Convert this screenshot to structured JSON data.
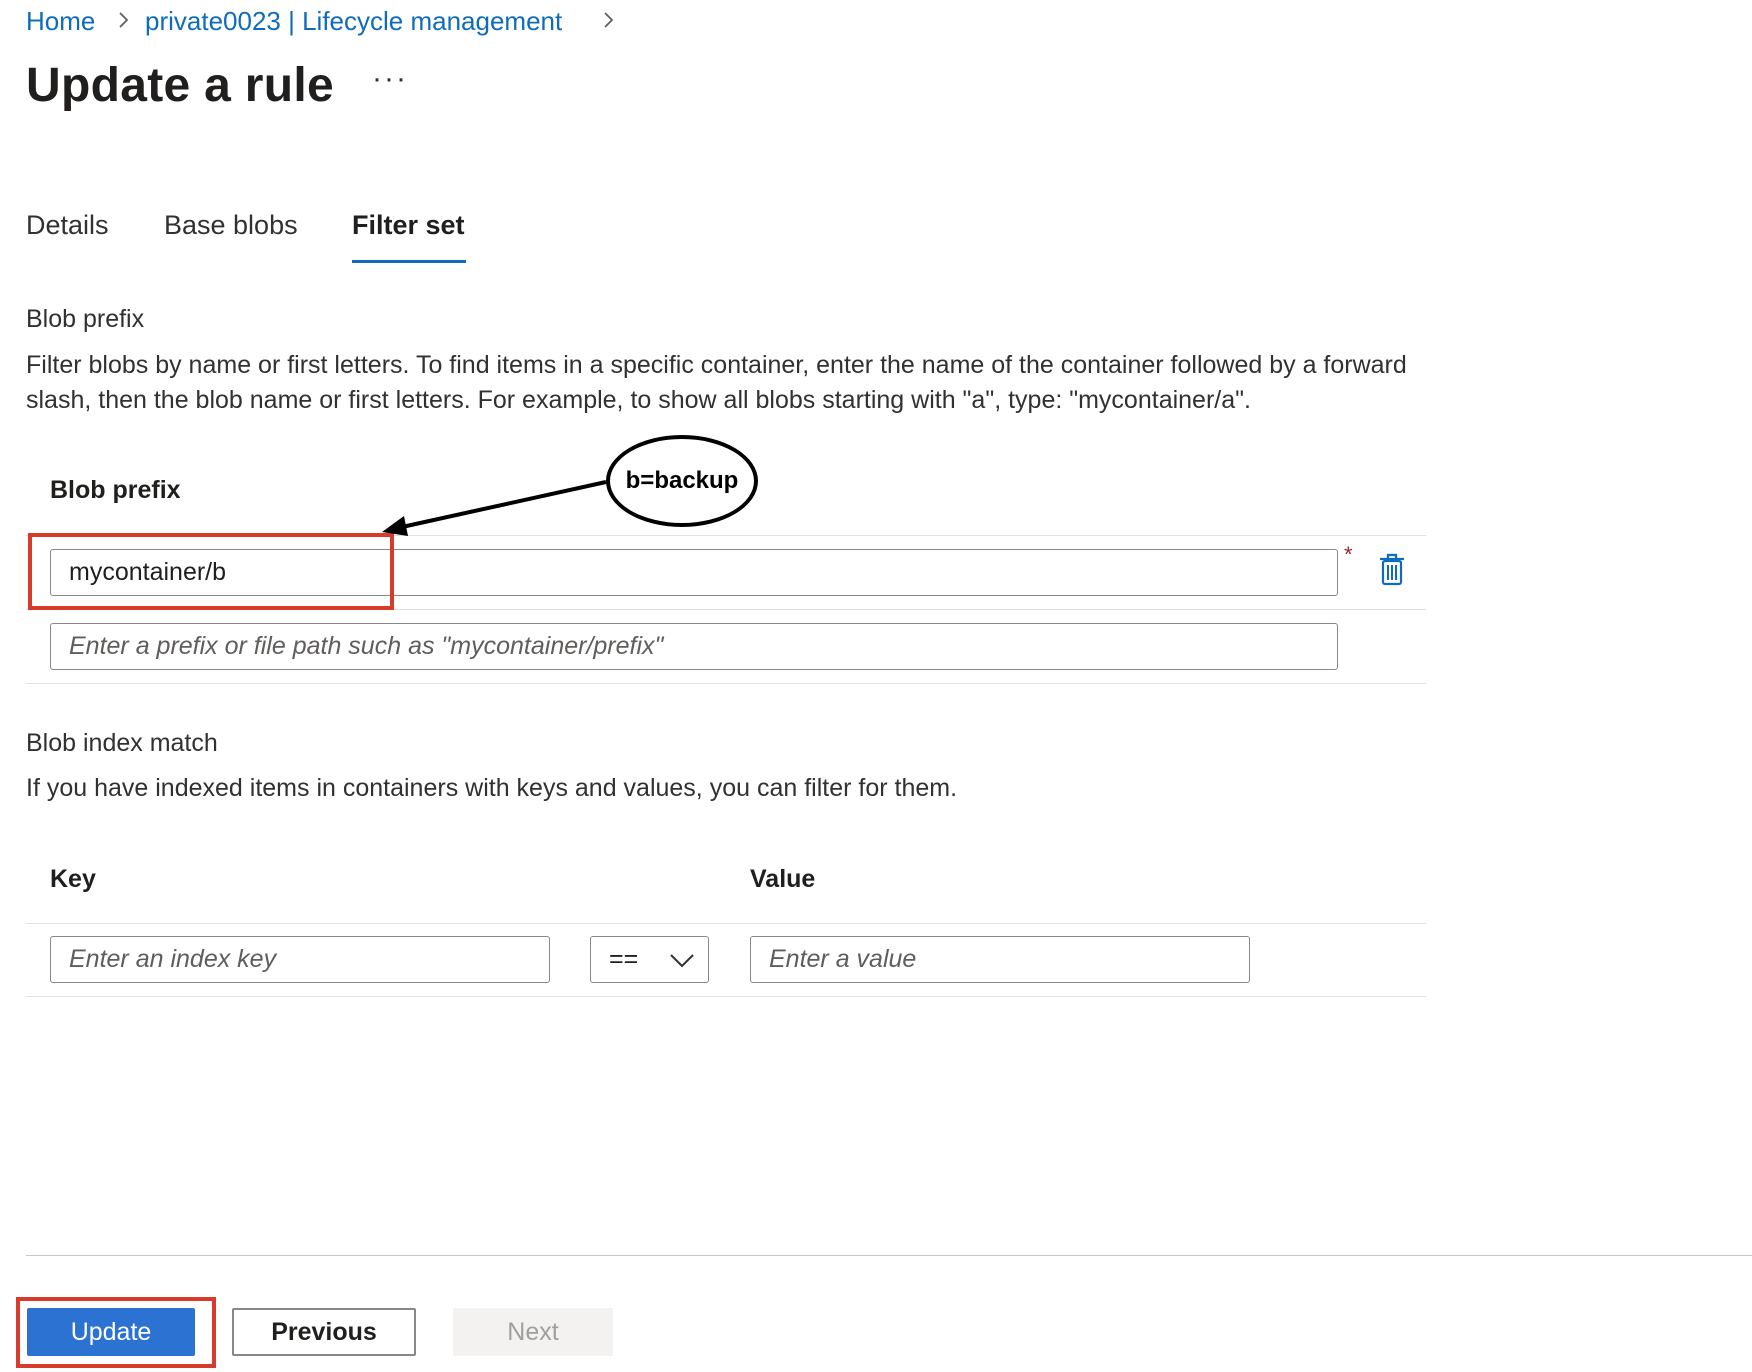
{
  "breadcrumb": {
    "home": "Home",
    "parent": "private0023 | Lifecycle management"
  },
  "page": {
    "title": "Update a rule",
    "more": "···"
  },
  "tabs": [
    {
      "label": "Details",
      "active": false
    },
    {
      "label": "Base blobs",
      "active": false
    },
    {
      "label": "Filter set",
      "active": true
    }
  ],
  "blob_prefix_section": {
    "heading": "Blob prefix",
    "description": "Filter blobs by name or first letters. To find items in a specific container, enter the name of the container followed by a forward slash, then the blob name or first letters. For example, to show all blobs starting with \"a\", type: \"mycontainer/a\".",
    "column_header": "Blob prefix",
    "row1_value": "mycontainer/b",
    "required_mark": "*",
    "row2_placeholder": "Enter a prefix or file path such as \"mycontainer/prefix\""
  },
  "annotation": {
    "callout_text": "b=backup"
  },
  "blob_index_section": {
    "heading": "Blob index match",
    "description": "If you have indexed items in containers with keys and values, you can filter for them.",
    "key_header": "Key",
    "value_header": "Value",
    "key_placeholder": "Enter an index key",
    "operator_value": "==",
    "value_placeholder": "Enter a value"
  },
  "footer": {
    "update_label": "Update",
    "previous_label": "Previous",
    "next_label": "Next"
  },
  "colors": {
    "accent": "#0f6cbd",
    "primary_button": "#2b72d3",
    "annotation_red": "#d83b2b"
  }
}
